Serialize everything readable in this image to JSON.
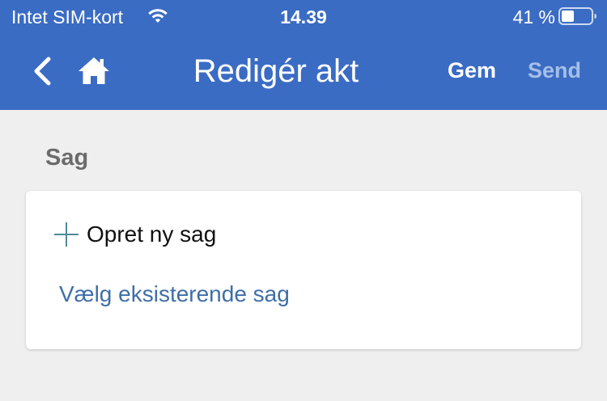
{
  "status_bar": {
    "carrier": "Intet SIM-kort",
    "time": "14.39",
    "battery": "41 %",
    "wifi_icon": "wifi-icon",
    "battery_icon": "battery-icon"
  },
  "nav": {
    "title": "Redigér akt",
    "back_icon": "chevron-left-icon",
    "home_icon": "home-icon",
    "save_label": "Gem",
    "send_label": "Send"
  },
  "section": {
    "title": "Sag"
  },
  "card": {
    "create_label": "Opret ny sag",
    "create_icon": "plus-icon",
    "choose_label": "Vælg eksisterende sag"
  },
  "colors": {
    "header_bg": "#3b6cc4",
    "page_bg": "#efefef",
    "link": "#3f6ea8",
    "disabled_action": "#a4bfe8",
    "section_title": "#6b6b6b"
  }
}
